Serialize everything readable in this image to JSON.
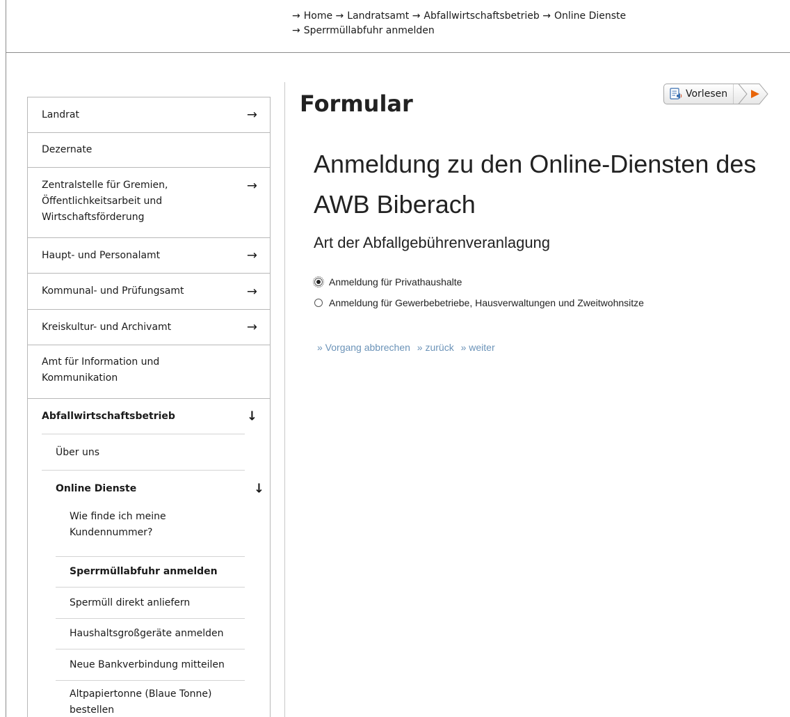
{
  "breadcrumb": {
    "items": [
      "Home",
      "Landratsamt",
      "Abfallwirtschaftsbetrieb",
      "Online Dienste",
      "Sperrmüllabfuhr anmelden"
    ],
    "arrow": "→"
  },
  "sidebar": {
    "items": [
      {
        "label": "Landrat",
        "arrow": "→"
      },
      {
        "label": "Dezernate"
      },
      {
        "label": "Zentralstelle für Gremien, Öffentlichkeitsarbeit und Wirtschaftsförderung",
        "arrow": "→"
      },
      {
        "label": "Haupt- und Personalamt",
        "arrow": "→"
      },
      {
        "label": "Kommunal- und Prüfungsamt",
        "arrow": "→"
      },
      {
        "label": "Kreiskultur- und Archivamt",
        "arrow": "→"
      },
      {
        "label": "Amt für Information und Kommunikation"
      },
      {
        "label": "Abfallwirtschaftsbetrieb",
        "arrow": "↓"
      }
    ],
    "sub": [
      {
        "label": "Über uns"
      },
      {
        "label": "Online Dienste",
        "arrow": "↓"
      }
    ],
    "subsub": [
      {
        "label": "Wie finde ich meine Kundennummer?"
      },
      {
        "label": "Sperrmüllabfuhr anmelden"
      },
      {
        "label": "Spermüll direkt anliefern"
      },
      {
        "label": "Haushaltsgroßgeräte anmelden"
      },
      {
        "label": "Neue Bankverbindung mitteilen"
      },
      {
        "label": "Altpapiertonne (Blaue Tonne) bestellen"
      }
    ]
  },
  "main": {
    "title": "Formular",
    "read_button": "Vorlesen",
    "heading": "Anmeldung zu den Online-Diensten des AWB Biberach",
    "subheading": "Art der Abfallgebührenveranlagung",
    "options": [
      {
        "label": "Anmeldung für Privathaushalte",
        "checked": true
      },
      {
        "label": "Anmeldung für Gewerbebetriebe, Hausverwaltungen und Zweitwohnsitze",
        "checked": false
      }
    ],
    "actions": [
      "» Vorgang abbrechen",
      "» zurück",
      "» weiter"
    ]
  },
  "colors": {
    "link": "#6b93b8",
    "play_accent": "#e8650a",
    "border": "#b8b8b8"
  }
}
